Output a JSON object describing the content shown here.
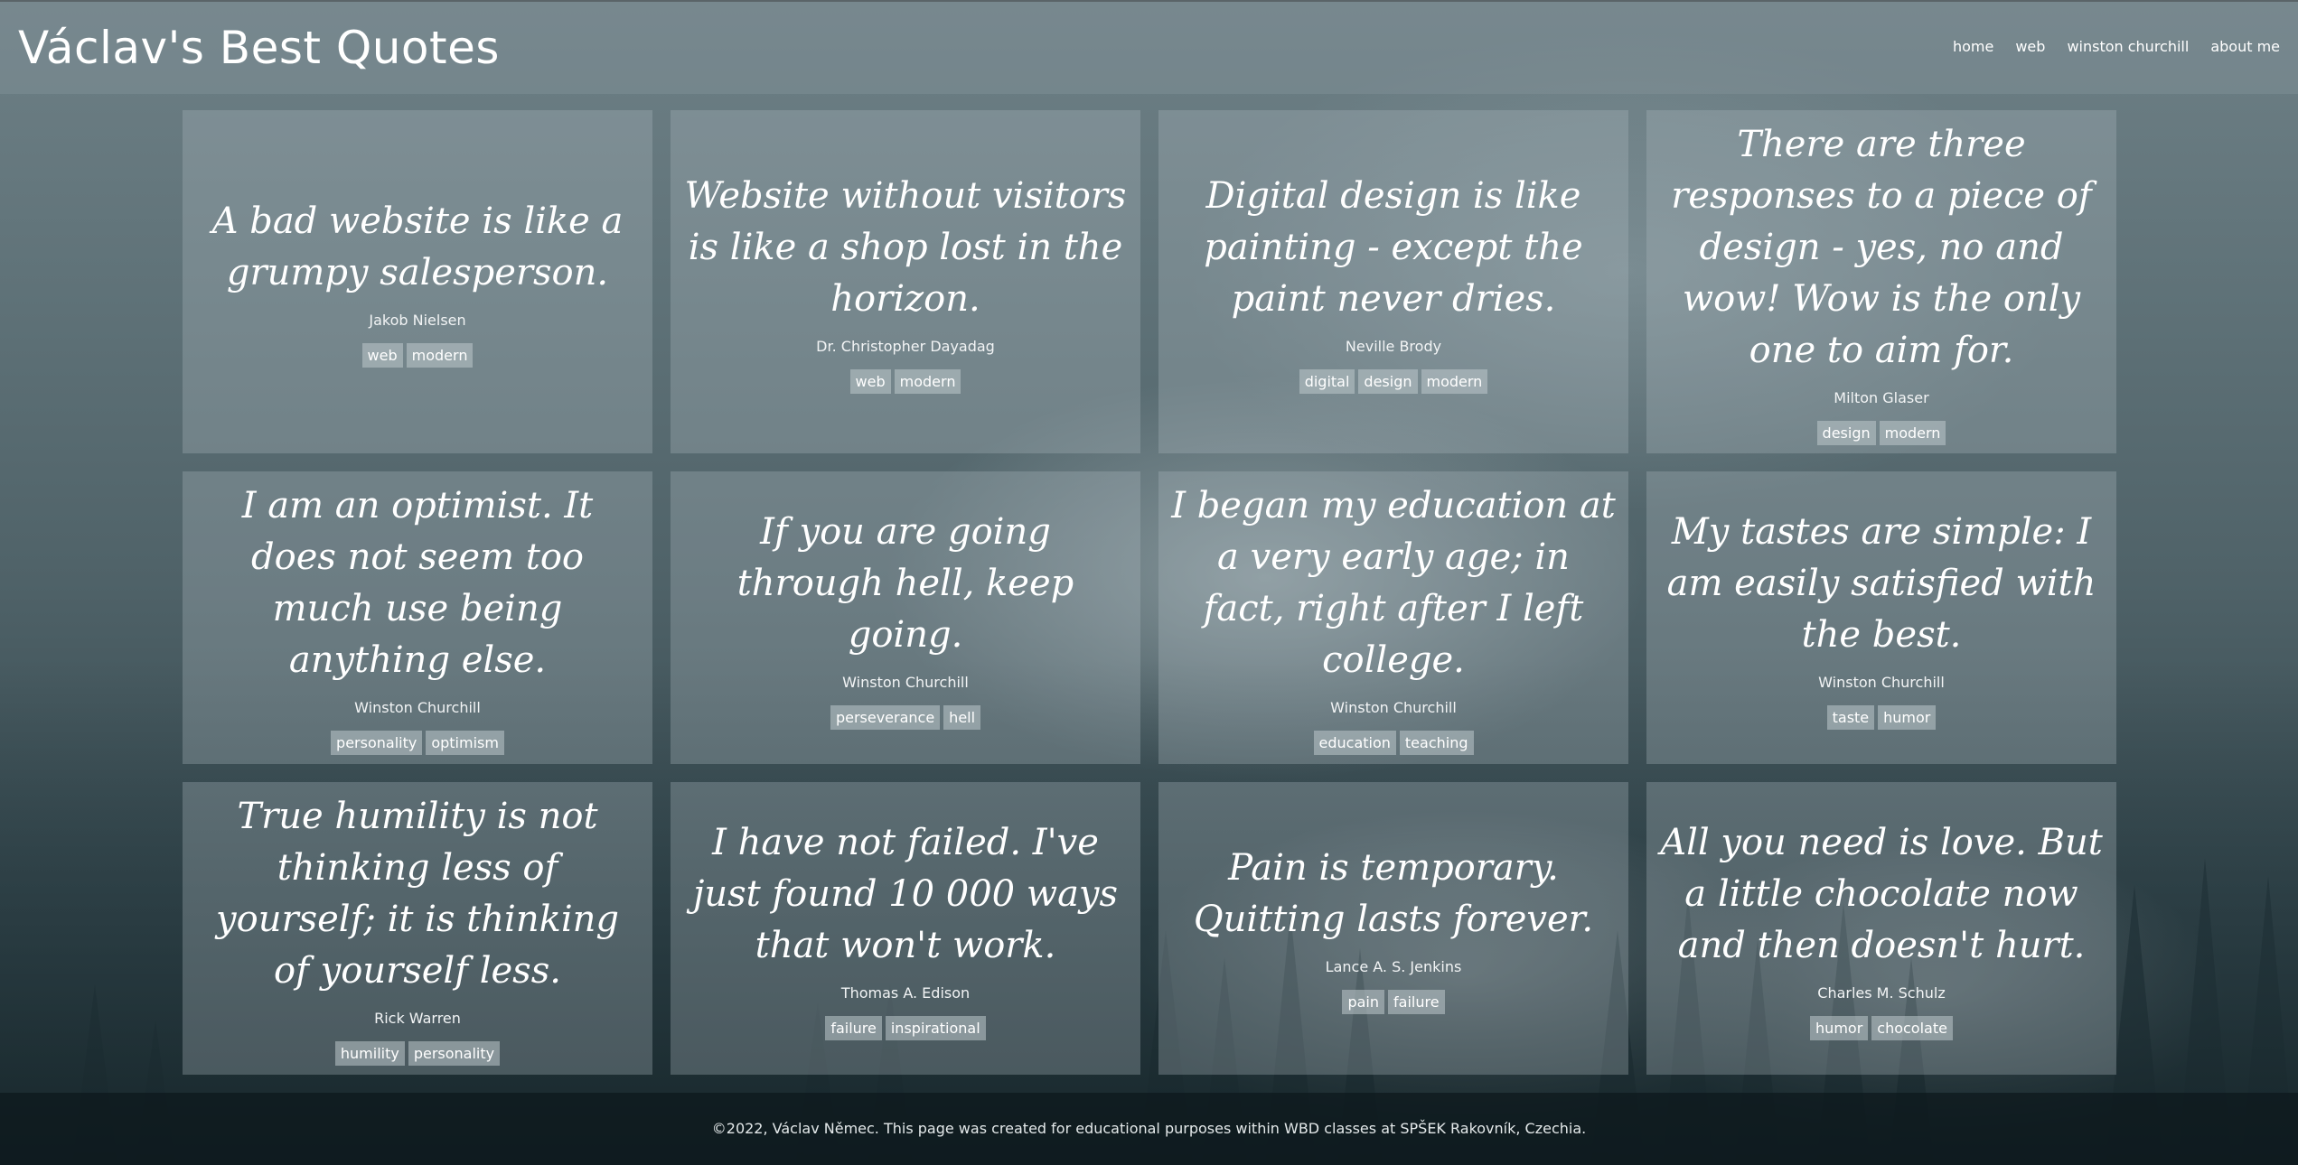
{
  "site_title": "Václav's Best Quotes",
  "nav": [
    {
      "label": "home"
    },
    {
      "label": "web"
    },
    {
      "label": "winston churchill"
    },
    {
      "label": "about me"
    }
  ],
  "cards": [
    {
      "quote": "A bad website is like a grumpy salesperson.",
      "author": "Jakob Nielsen",
      "tags": [
        "web",
        "modern"
      ]
    },
    {
      "quote": "Website without visitors is like a shop lost in the horizon.",
      "author": "Dr. Christopher Dayadag",
      "tags": [
        "web",
        "modern"
      ]
    },
    {
      "quote": "Digital design is like painting - except the paint never dries.",
      "author": "Neville Brody",
      "tags": [
        "digital",
        "design",
        "modern"
      ]
    },
    {
      "quote": "There are three responses to a piece of design - yes, no and wow! Wow is the only one to aim for.",
      "author": "Milton Glaser",
      "tags": [
        "design",
        "modern"
      ]
    },
    {
      "quote": "I am an optimist. It does not seem too much use being anything else.",
      "author": "Winston Churchill",
      "tags": [
        "personality",
        "optimism"
      ]
    },
    {
      "quote": "If you are going through hell, keep going.",
      "author": "Winston Churchill",
      "tags": [
        "perseverance",
        "hell"
      ]
    },
    {
      "quote": "I began my education at a very early age; in fact, right after I left college.",
      "author": "Winston Churchill",
      "tags": [
        "education",
        "teaching"
      ]
    },
    {
      "quote": "My tastes are simple: I am easily satisfied with the best.",
      "author": "Winston Churchill",
      "tags": [
        "taste",
        "humor"
      ]
    },
    {
      "quote": "True humility is not thinking less of yourself; it is thinking of yourself less.",
      "author": "Rick Warren",
      "tags": [
        "humility",
        "personality"
      ]
    },
    {
      "quote": "I have not failed. I've just found 10 000 ways that won't work.",
      "author": "Thomas A. Edison",
      "tags": [
        "failure",
        "inspirational"
      ]
    },
    {
      "quote": "Pain is temporary. Quitting lasts forever.",
      "author": "Lance A. S. Jenkins",
      "tags": [
        "pain",
        "failure"
      ]
    },
    {
      "quote": "All you need is love. But a little chocolate now and then doesn't hurt.",
      "author": "Charles M. Schulz",
      "tags": [
        "humor",
        "chocolate"
      ]
    }
  ],
  "footer": {
    "text": "©2022, Václav Němec. This page was created for educational purposes within WBD classes at SPŠEK Rakovník, Czechia."
  }
}
